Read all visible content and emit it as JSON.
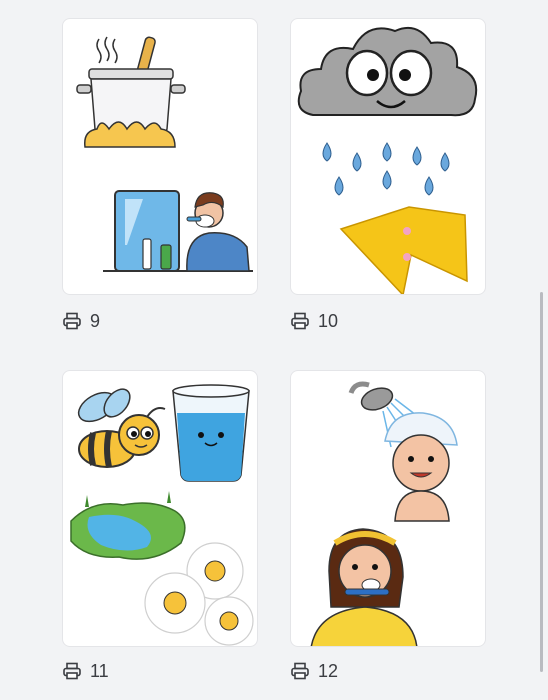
{
  "cards": [
    {
      "id": 9,
      "page_label": "9",
      "pictures": [
        "cooking-pot",
        "man-shaving"
      ]
    },
    {
      "id": 10,
      "page_label": "10",
      "pictures": [
        "rain-cloud",
        "lightning-bolt"
      ]
    },
    {
      "id": 11,
      "page_label": "11",
      "pictures": [
        "bee",
        "glass-of-water",
        "river",
        "daisies"
      ]
    },
    {
      "id": 12,
      "page_label": "12",
      "pictures": [
        "child-showering",
        "girl-brushing-teeth"
      ]
    }
  ],
  "icons": {
    "page_icon": "printer-icon"
  },
  "colors": {
    "background": "#f2f3f5",
    "card": "#ffffff",
    "text": "#3b3d42"
  }
}
